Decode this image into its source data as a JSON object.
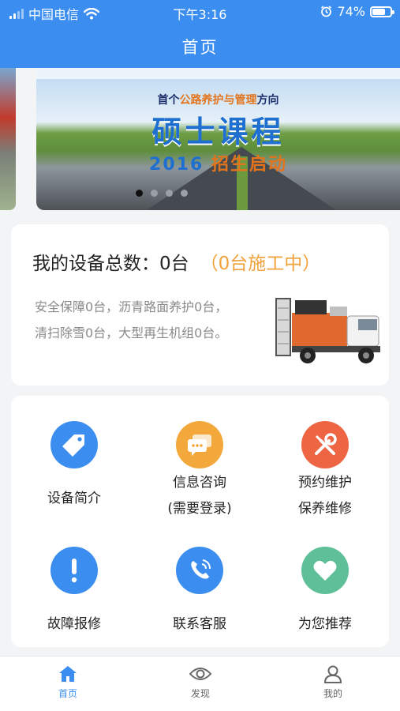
{
  "status": {
    "carrier": "中国电信",
    "time": "下午3:16",
    "battery": "74%"
  },
  "nav": {
    "title": "首页"
  },
  "banner": {
    "line1_a": "首个",
    "line1_b": "公路养护与管理",
    "line1_c": "方向",
    "line2": "硕士课程",
    "line3_a": "2016",
    "line3_b": "招生启动"
  },
  "devices": {
    "title": "我的设备总数：0台",
    "working": "（0台施工中）",
    "desc_line1": "安全保障0台，沥青路面养护0台，",
    "desc_line2": "清扫除雪0台，大型再生机组0台。"
  },
  "grid": [
    {
      "label": "设备简介",
      "icon": "tag-icon",
      "color": "#3b8ef0"
    },
    {
      "label_line1": "信息咨询",
      "label_line2": "(需要登录)",
      "icon": "chat-icon",
      "color": "#f2a83b"
    },
    {
      "label_line1": "预约维护",
      "label_line2": "保养维修",
      "icon": "tools-icon",
      "color": "#ee6543"
    },
    {
      "label": "故障报修",
      "icon": "alert-icon",
      "color": "#3b8ef0"
    },
    {
      "label": "联系客服",
      "icon": "phone-icon",
      "color": "#3b8ef0"
    },
    {
      "label": "为您推荐",
      "icon": "heart-icon",
      "color": "#5fbf98"
    }
  ],
  "tabs": [
    {
      "label": "首页",
      "icon": "home-icon",
      "active": true
    },
    {
      "label": "发现",
      "icon": "eye-icon"
    },
    {
      "label": "我的",
      "icon": "user-icon"
    }
  ]
}
